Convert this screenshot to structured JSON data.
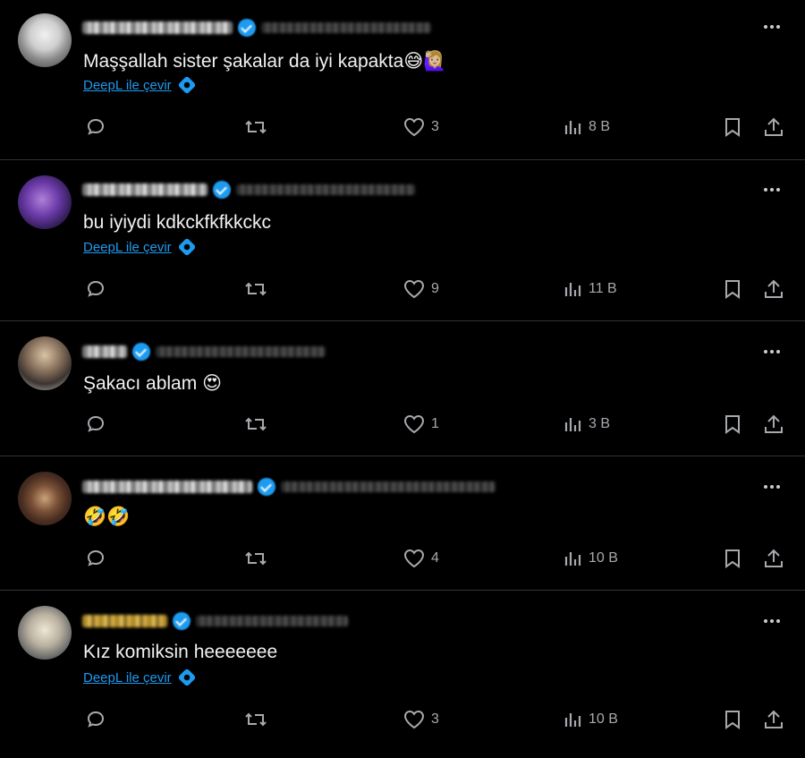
{
  "tweets": [
    {
      "text": "Maşşallah sister şakalar da iyi kapakta",
      "emojis": "😅🙋🏼‍♀️",
      "translate_label": "DeepL ile çevir",
      "has_translate": true,
      "likes": "3",
      "views": "8 B"
    },
    {
      "text": "bu iyiydi kdkckfkfkkckc",
      "emojis": "",
      "translate_label": "DeepL ile çevir",
      "has_translate": true,
      "likes": "9",
      "views": "11 B"
    },
    {
      "text": "Şakacı ablam",
      "emojis": "😍",
      "translate_label": "",
      "has_translate": false,
      "likes": "1",
      "views": "3 B"
    },
    {
      "text": "",
      "emojis": "🤣🤣",
      "translate_label": "",
      "has_translate": false,
      "likes": "4",
      "views": "10 B"
    },
    {
      "text": "Kız komiksin heeeeeee",
      "emojis": "",
      "translate_label": "DeepL ile çevir",
      "has_translate": true,
      "likes": "3",
      "views": "10 B"
    }
  ],
  "icons": {
    "reply": "reply-icon",
    "retweet": "retweet-icon",
    "like": "heart-icon",
    "views": "views-icon",
    "bookmark": "bookmark-icon",
    "share": "share-icon",
    "more": "more-icon",
    "verified": "verified-badge-icon",
    "deepl": "deepl-icon"
  },
  "colors": {
    "background": "#000000",
    "text": "#e7e9ea",
    "muted": "#a6a9ad",
    "link": "#1d9bf0",
    "verified": "#1d9bf0"
  }
}
